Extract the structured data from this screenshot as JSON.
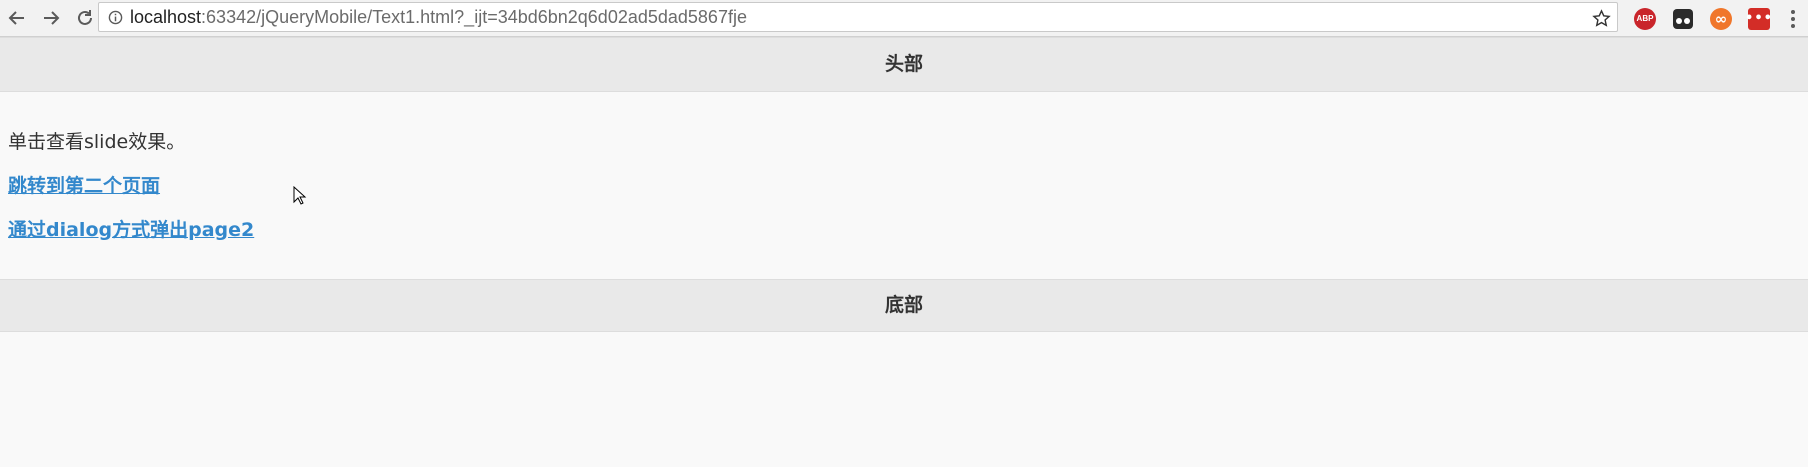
{
  "browser": {
    "back_icon": "back-arrow-icon",
    "forward_icon": "forward-arrow-icon",
    "reload_icon": "reload-icon",
    "url_host": "localhost",
    "url_rest": ":63342/jQueryMobile/Text1.html?_ijt=34bd6bn2q6d02ad5dad5867fje",
    "extensions": {
      "abp_label": "ABP",
      "lastpass_label": "•••"
    }
  },
  "page": {
    "header_title": "头部",
    "intro_text": "单击查看slide效果。",
    "link_page2": "跳转到第二个页面",
    "link_dialog": "通过dialog方式弹出page2",
    "footer_title": "底部"
  },
  "colors": {
    "link": "#3388cc",
    "bar_bg": "#e9e9e9",
    "page_bg": "#f9f9f9"
  }
}
